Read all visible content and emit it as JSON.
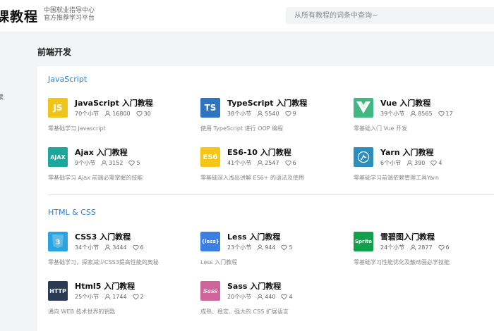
{
  "header": {
    "logo": "课教程",
    "tagline": [
      "中国就业指导中心",
      "官方推荐学习平台"
    ],
    "search_placeholder": "从所有教程的词条中查询~"
  },
  "side_mark": "读",
  "section_title": "前端开发",
  "categories": [
    {
      "title": "JavaScript",
      "courses": [
        {
          "title": "JavaScript 入门教程",
          "sections": "70个小节",
          "learners": "16800",
          "likes": "30",
          "desc": "零基础学习 Javascript",
          "icon": "js-icon",
          "icon_text": "JS",
          "icon_bg": "#f0c419",
          "icon_fg": "#ffffff"
        },
        {
          "title": "TypeScript 入门教程",
          "sections": "38个小节",
          "learners": "5540",
          "likes": "9",
          "desc": "使用 TypeScript 进行 OOP 编程",
          "icon": "ts-icon",
          "icon_text": "TS",
          "icon_bg": "#2f74c0",
          "icon_fg": "#ffffff"
        },
        {
          "title": "Vue 入门教程",
          "sections": "39个小节",
          "learners": "8565",
          "likes": "17",
          "desc": "零基础入门 Vue 开发",
          "icon": "vue-icon",
          "icon_text": "",
          "icon_bg": "#41b883",
          "icon_fg": "#ffffff"
        },
        {
          "title": "Ajax 入门教程",
          "sections": "9个小节",
          "learners": "3152",
          "likes": "5",
          "desc": "零基础学习 Ajax 前端必需掌握的技能",
          "icon": "ajax-icon",
          "icon_text": "AJAX",
          "icon_bg": "#1ba89a",
          "icon_fg": "#ffffff"
        },
        {
          "title": "ES6-10 入门教程",
          "sections": "41个小节",
          "learners": "2547",
          "likes": "6",
          "desc": "零基础深入浅出讲解 ES6+ 的语法及使用",
          "icon": "es6-icon",
          "icon_text": "ES6",
          "icon_bg": "#f5c518",
          "icon_fg": "#ffffff"
        },
        {
          "title": "Yarn 入门教程",
          "sections": "6个小节",
          "learners": "390",
          "likes": "4",
          "desc": "零基础学习前端依赖管理工具Yarn",
          "icon": "yarn-icon",
          "icon_text": "",
          "icon_bg": "#2c8ebb",
          "icon_fg": "#ffffff"
        }
      ]
    },
    {
      "title": "HTML & CSS",
      "courses": [
        {
          "title": "CSS3 入门教程",
          "sections": "34个小节",
          "learners": "3444",
          "likes": "6",
          "desc": "零基础学习，探索减少CSS3提高性能的奥秘",
          "icon": "css3-icon",
          "icon_text": "3",
          "icon_bg": "#2aa3e0",
          "icon_fg": "#ffffff"
        },
        {
          "title": "Less 入门教程",
          "sections": "23个小节",
          "learners": "944",
          "likes": "5",
          "desc": "Less 入门教程",
          "icon": "less-icon",
          "icon_text": "{less}",
          "icon_bg": "#3b7fe0",
          "icon_fg": "#ffffff"
        },
        {
          "title": "雪碧图入门教程",
          "sections": "24个小节",
          "learners": "2877",
          "likes": "6",
          "desc": "零基础学习性能优化及触动画必学技能",
          "icon": "sprite-icon",
          "icon_text": "Sprite",
          "icon_bg": "#12a14a",
          "icon_fg": "#ffffff"
        },
        {
          "title": "Html5 入门教程",
          "sections": "25个小节",
          "learners": "1744",
          "likes": "2",
          "desc": "通向 WEB 技术世界的钥匙",
          "icon": "html5-icon",
          "icon_text": "HTTP",
          "icon_bg": "#2a3a55",
          "icon_fg": "#ffffff"
        },
        {
          "title": "Sass 入门教程",
          "sections": "20个小节",
          "learners": "440",
          "likes": "4",
          "desc": "成熟、稳定、强大的 CSS 扩展语言",
          "icon": "sass-icon",
          "icon_text": "Sass",
          "icon_bg": "#cf649a",
          "icon_fg": "#ffffff"
        }
      ]
    }
  ]
}
